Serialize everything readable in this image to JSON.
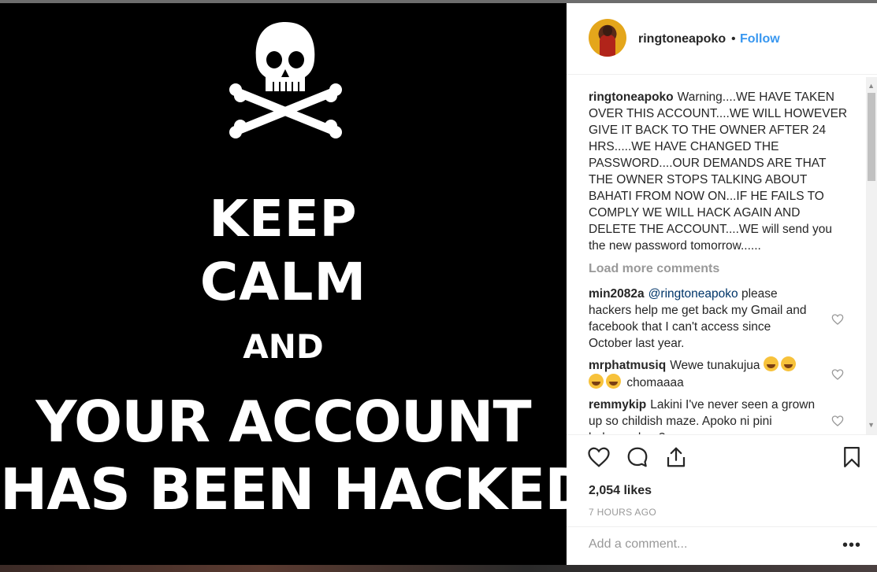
{
  "poster": {
    "line1": "KEEP",
    "line2": "CALM",
    "line3": "AND",
    "line4": "YOUR ACCOUNT",
    "line5": "HAS BEEN HACKED"
  },
  "post": {
    "username": "ringtoneapoko",
    "dot": "•",
    "follow_label": "Follow",
    "caption_user": "ringtoneapoko",
    "caption_text": "Warning....WE HAVE TAKEN OVER THIS ACCOUNT....WE WILL HOWEVER GIVE IT BACK TO THE OWNER AFTER 24 HRS.....WE HAVE CHANGED THE PASSWORD....OUR DEMANDS ARE THAT THE OWNER STOPS TALKING ABOUT BAHATI FROM NOW ON...IF HE FAILS TO COMPLY WE WILL HACK AGAIN AND DELETE THE ACCOUNT....WE will send you the new password tomorrow......",
    "load_more": "Load more comments",
    "likes": "2,054 likes",
    "time": "7 HOURS AGO",
    "add_comment_placeholder": "Add a comment...",
    "more_label": "•••"
  },
  "comments": [
    {
      "user": "min2082a",
      "mention": "@ringtoneapoko",
      "text": "please hackers help me get back my Gmail and facebook that I can't access since October last year."
    },
    {
      "user": "mrphatmusiq",
      "text": "Wewe tunakujua",
      "text2": "chomaaaa"
    },
    {
      "user": "remmykip",
      "text": "Lakini I've never seen a grown up so childish maze. Apoko ni pini bukusumbua?"
    }
  ],
  "icons": {
    "skull": "skull-crossbones-icon",
    "heart": "heart-icon",
    "comment": "comment-icon",
    "share": "share-icon",
    "bookmark": "bookmark-icon",
    "emoji": "tears-of-joy-emoji"
  },
  "colors": {
    "link": "#3897f0",
    "text": "#262626",
    "muted": "#999999",
    "poster_bg": "#000000"
  }
}
